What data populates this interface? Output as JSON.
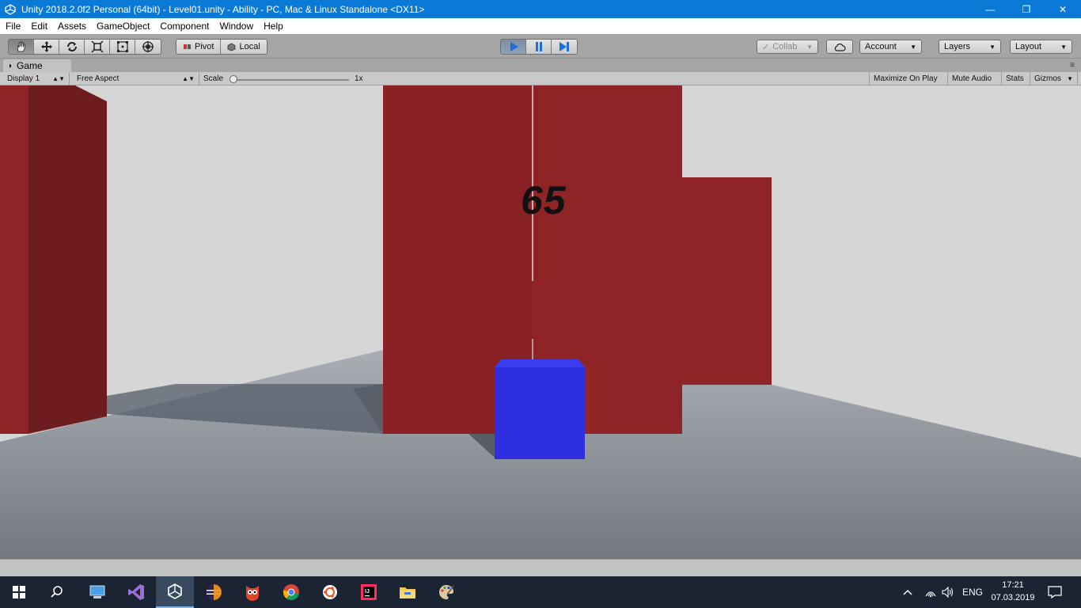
{
  "window": {
    "title": "Unity 2018.2.0f2 Personal (64bit) - Level01.unity - Ability - PC, Mac & Linux Standalone <DX11>",
    "minimize": "—",
    "restore": "❐",
    "close": "✕"
  },
  "menu": [
    "File",
    "Edit",
    "Assets",
    "GameObject",
    "Component",
    "Window",
    "Help"
  ],
  "toolbar": {
    "pivot": "Pivot",
    "local": "Local",
    "collab": "Collab",
    "account": "Account",
    "layers": "Layers",
    "layout": "Layout"
  },
  "game_tab": {
    "label": "Game",
    "display": "Display 1",
    "aspect": "Free Aspect",
    "scale_label": "Scale",
    "scale_value": "1x",
    "maximize": "Maximize On Play",
    "mute": "Mute Audio",
    "stats": "Stats",
    "gizmos": "Gizmos"
  },
  "game": {
    "score": "65"
  },
  "taskbar": {
    "lang": "ENG",
    "time": "17:21",
    "date": "07.03.2019"
  },
  "colors": {
    "titlebar": "#0a7ad6",
    "wall_red": "#8f2427",
    "cube_blue": "#2d2fe0",
    "taskbar": "#1a2433"
  }
}
